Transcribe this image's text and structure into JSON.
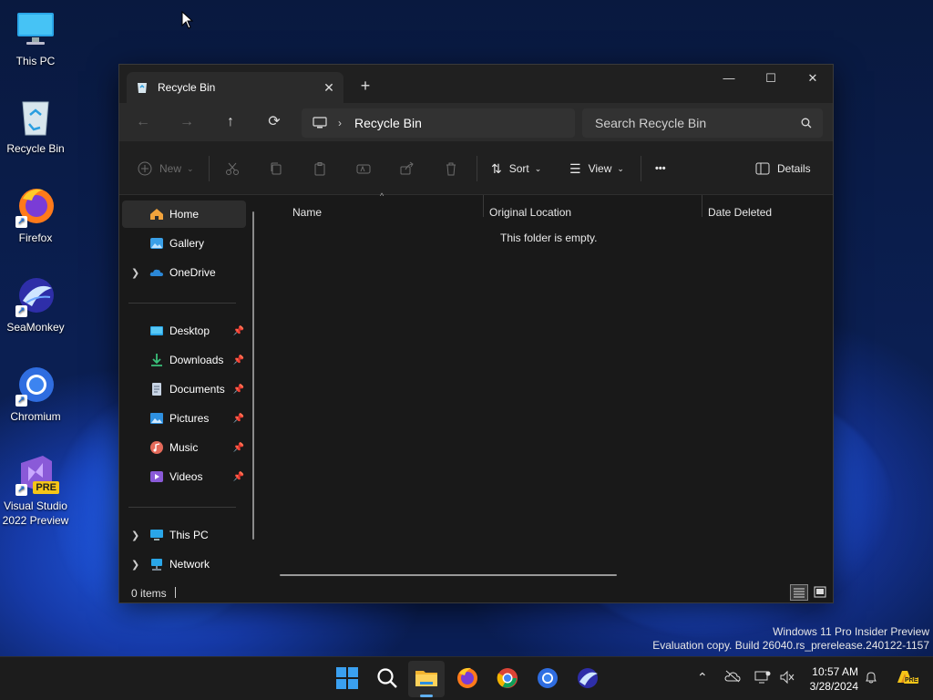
{
  "desktop": {
    "icons": [
      {
        "label": "This PC"
      },
      {
        "label": "Recycle Bin"
      },
      {
        "label": "Firefox"
      },
      {
        "label": "SeaMonkey"
      },
      {
        "label": "Chromium"
      },
      {
        "label_line1": "Visual Studio",
        "label_line2": "2022 Preview",
        "badge": "PRE"
      }
    ]
  },
  "window": {
    "tab_title": "Recycle Bin",
    "tab_close": "✕",
    "new_tab": "+",
    "controls": {
      "minimize": "—",
      "maximize": "☐",
      "close": "✕"
    },
    "nav": {
      "back": "←",
      "forward": "→",
      "up": "↑",
      "refresh": "⟳"
    },
    "address": {
      "separator": "›",
      "location": "Recycle Bin"
    },
    "search": {
      "placeholder": "Search Recycle Bin"
    },
    "commands": {
      "new_label": "New",
      "sort_label": "Sort",
      "view_label": "View",
      "more_label": "•••",
      "details_label": "Details"
    },
    "sidebar": {
      "home": "Home",
      "gallery": "Gallery",
      "onedrive": "OneDrive",
      "desktop": "Desktop",
      "downloads": "Downloads",
      "documents": "Documents",
      "pictures": "Pictures",
      "music": "Music",
      "videos": "Videos",
      "this_pc": "This PC",
      "network": "Network"
    },
    "columns": {
      "name": "Name",
      "original_location": "Original Location",
      "date_deleted": "Date Deleted"
    },
    "empty_message": "This folder is empty.",
    "status": {
      "items": "0 items"
    }
  },
  "watermark": {
    "line1": "Windows 11 Pro Insider Preview",
    "line2": "Evaluation copy. Build 26040.rs_prerelease.240122-1157"
  },
  "taskbar": {
    "time": "10:57 AM",
    "date": "3/28/2024",
    "copilot_badge": "PRE"
  },
  "colors": {
    "accent": "#60b0f0",
    "window_bg": "#191919",
    "taskbar_bg": "#1c1c1c"
  }
}
